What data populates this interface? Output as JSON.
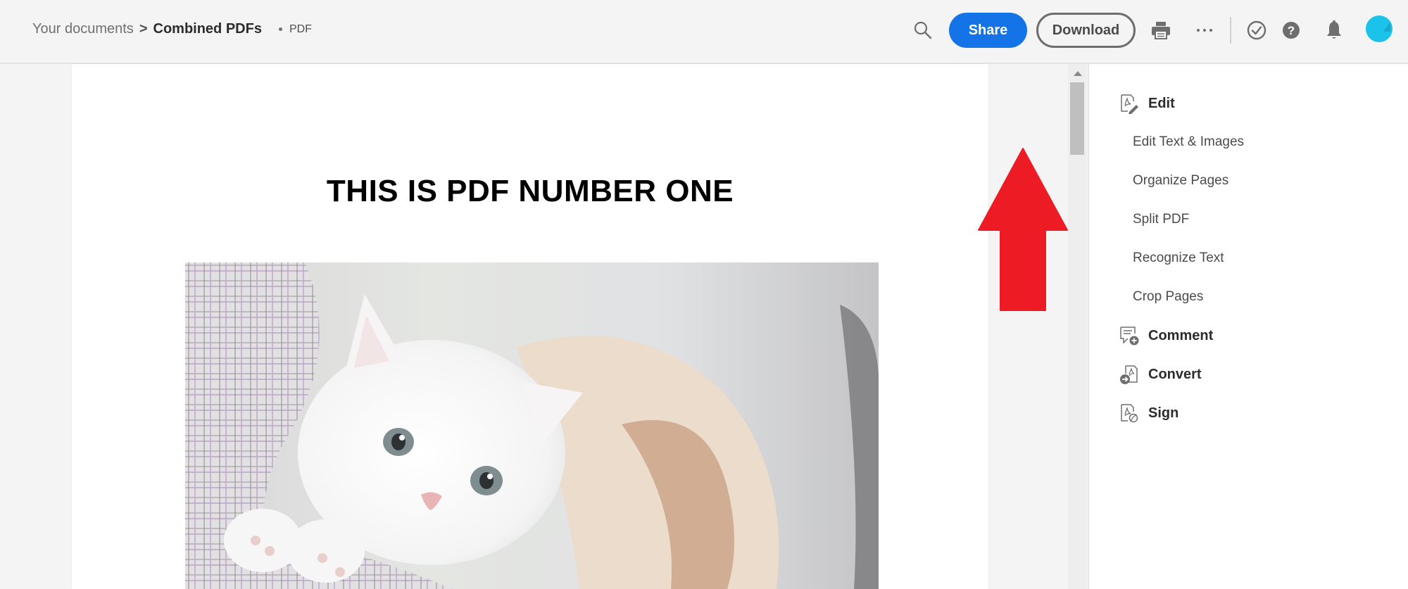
{
  "breadcrumb": {
    "root": "Your documents",
    "separator": ">",
    "current": "Combined PDFs",
    "file_type": "PDF"
  },
  "toolbar": {
    "search_icon": "search-icon",
    "share_label": "Share",
    "download_label": "Download",
    "print_icon": "print-icon",
    "more_icon": "more-horizontal-icon",
    "task_icon": "checkmark-circle-icon",
    "help_icon": "help-icon",
    "notifications_icon": "bell-icon",
    "avatar_icon": "user-avatar"
  },
  "colors": {
    "accent": "#1473e6",
    "annotation_arrow": "#ed1c24",
    "avatar": "#1bc2ea"
  },
  "document": {
    "title": "THIS IS PDF NUMBER ONE",
    "image_alt": "White kitten peeking out of a plaid shirt pocket"
  },
  "annotation": {
    "type": "arrow-up",
    "color": "#ed1c24"
  },
  "right_panel": {
    "items": [
      {
        "label": "Edit",
        "icon": "edit-pdf-icon",
        "level": "section"
      },
      {
        "label": "Edit Text & Images",
        "level": "sub"
      },
      {
        "label": "Organize Pages",
        "level": "sub"
      },
      {
        "label": "Split PDF",
        "level": "sub"
      },
      {
        "label": "Recognize Text",
        "level": "sub"
      },
      {
        "label": "Crop Pages",
        "level": "sub"
      },
      {
        "label": "Comment",
        "icon": "comment-add-icon",
        "level": "section"
      },
      {
        "label": "Convert",
        "icon": "convert-pdf-icon",
        "level": "section"
      },
      {
        "label": "Sign",
        "icon": "sign-pdf-icon",
        "level": "section"
      }
    ]
  }
}
